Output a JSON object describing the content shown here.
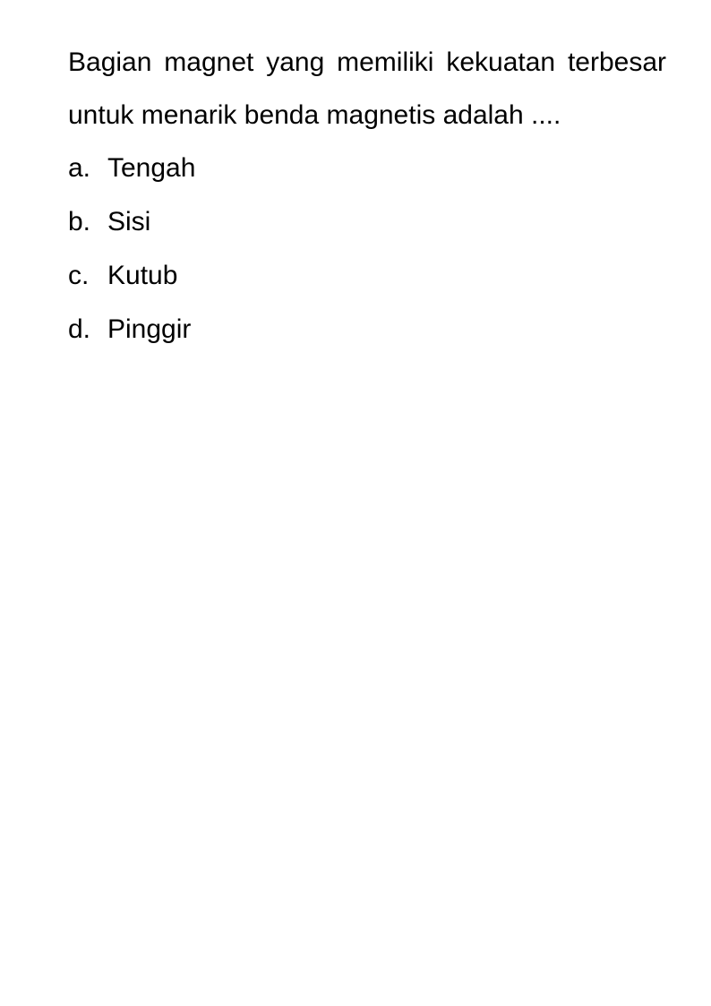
{
  "question": {
    "text": "Bagian magnet yang memiliki kekuatan terbesar untuk menarik benda magnetis adalah ...."
  },
  "options": [
    {
      "letter": "a.",
      "text": "Tengah"
    },
    {
      "letter": "b.",
      "text": "Sisi"
    },
    {
      "letter": "c.",
      "text": "Kutub"
    },
    {
      "letter": "d.",
      "text": "Pinggir"
    }
  ],
  "colors": {
    "text": "#000000",
    "background": "#ffffff"
  }
}
